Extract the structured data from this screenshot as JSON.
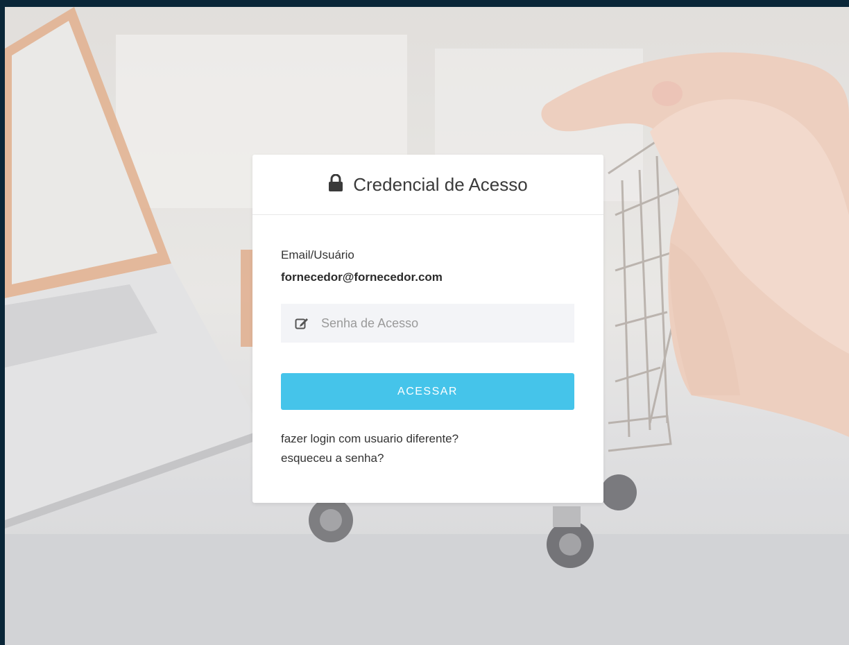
{
  "login": {
    "title": "Credencial de Acesso",
    "user_label": "Email/Usuário",
    "user_value": "fornecedor@fornecedor.com",
    "password_placeholder": "Senha de Acesso",
    "submit_label": "ACESSAR",
    "different_user_link": "fazer login com usuario diferente?",
    "forgot_password_link": "esqueceu a senha?"
  },
  "icons": {
    "header": "lock-icon",
    "password": "edit-icon"
  },
  "colors": {
    "frame": "#0a2638",
    "button": "#45c4ea",
    "input_bg": "#f3f4f7"
  }
}
